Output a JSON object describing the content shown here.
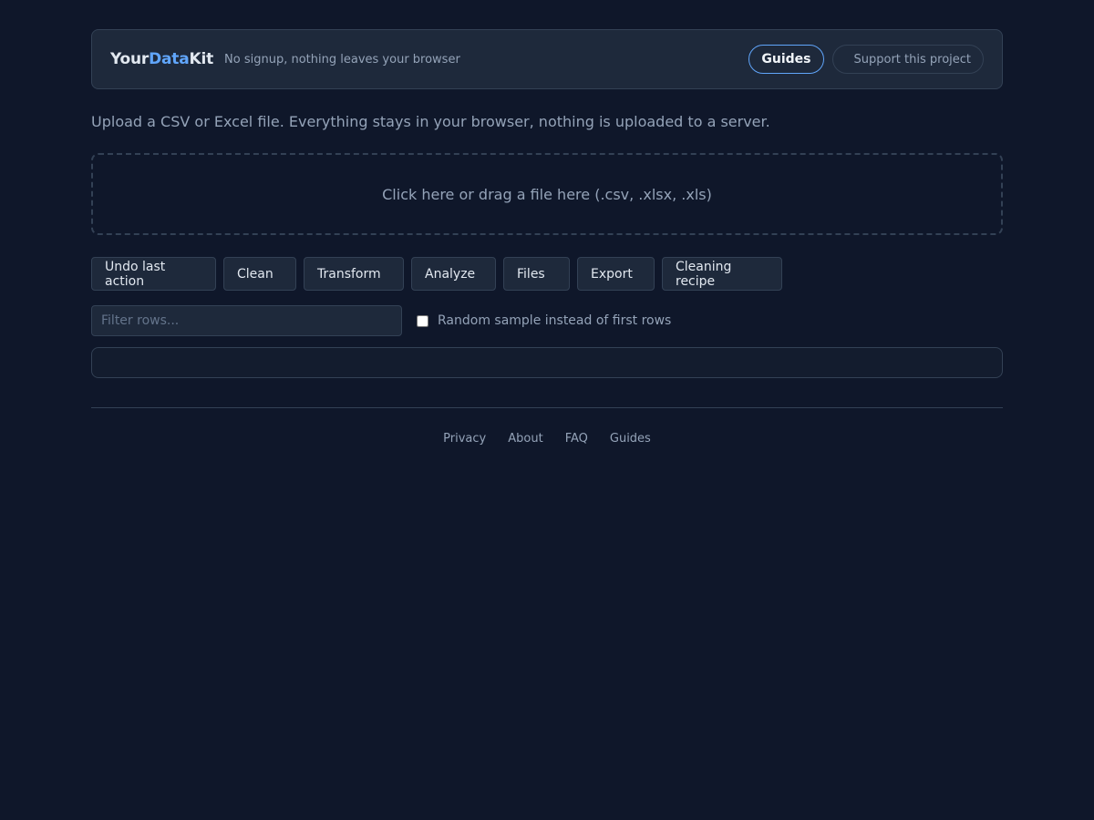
{
  "header": {
    "logo": {
      "part1": "Your",
      "part2": "Data",
      "part3": "Kit"
    },
    "tagline": "No signup, nothing leaves your browser",
    "guides_label": "Guides",
    "support_label": "Support this project"
  },
  "intro": "Upload a CSV or Excel file. Everything stays in your browser, nothing is uploaded to a server.",
  "dropzone": {
    "text": "Click here or drag a file here (.csv, .xlsx, .xls)"
  },
  "toolbar": {
    "undo": "Undo last action",
    "clean": "Clean",
    "transform": "Transform",
    "analyze": "Analyze",
    "files": "Files",
    "export": "Export",
    "recipe": "Cleaning recipe"
  },
  "filter": {
    "placeholder": "Filter rows...",
    "value": "",
    "sample_label": "Random sample instead of first rows",
    "sample_checked": false
  },
  "footer": {
    "links": [
      "Privacy",
      "About",
      "FAQ",
      "Guides"
    ]
  },
  "colors": {
    "background": "#0f172a",
    "panel": "#1e293b",
    "border": "#334155",
    "accent": "#60a5fa"
  }
}
